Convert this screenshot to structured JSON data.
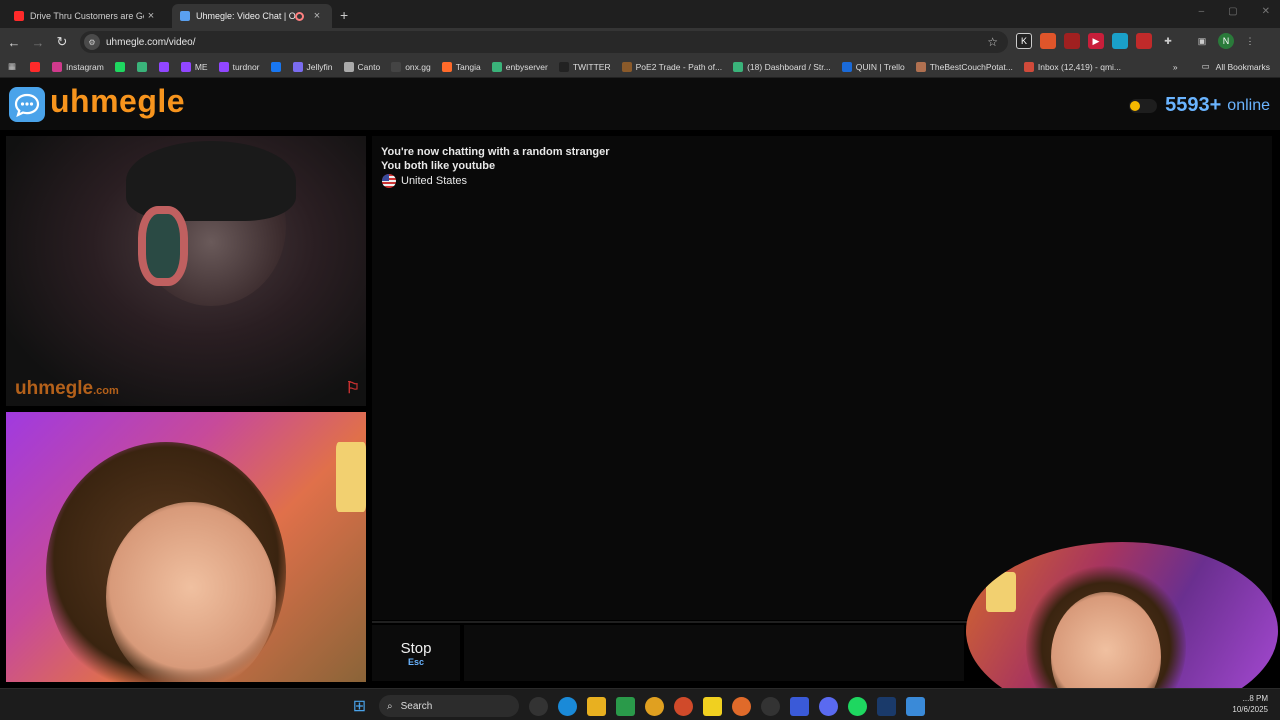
{
  "browser": {
    "tabs": [
      {
        "title": "Drive Thru Customers are Getti",
        "color": "#ff2a2a",
        "active": false
      },
      {
        "title": "Uhmegle: Video Chat | Ome",
        "color": "#5aa0f0",
        "active": true
      }
    ],
    "new_tab_symbol": "+",
    "close_symbol": "×",
    "window_controls": [
      "–",
      "▢",
      "✕"
    ],
    "url": "uhmegle.com/video/",
    "bookmarks": [
      {
        "label": "",
        "color": "#ff2a2a"
      },
      {
        "label": "Instagram",
        "color": "#d03a8c"
      },
      {
        "label": "",
        "color": "#1ed760"
      },
      {
        "label": "",
        "color": "#3ab37a"
      },
      {
        "label": "",
        "color": "#9146ff"
      },
      {
        "label": "ME",
        "color": "#9146ff"
      },
      {
        "label": "turdnor",
        "color": "#9146ff"
      },
      {
        "label": "",
        "color": "#1877f2"
      },
      {
        "label": "Jellyfin",
        "color": "#7a6cf0"
      },
      {
        "label": "Canto",
        "color": "#aaaaaa"
      },
      {
        "label": "onx.gg",
        "color": "#444444"
      },
      {
        "label": "Tangia",
        "color": "#ff6a2a"
      },
      {
        "label": "enbyserver",
        "color": "#3ab37a"
      },
      {
        "label": "TWITTER",
        "color": "#222222"
      },
      {
        "label": "PoE2 Trade - Path of...",
        "color": "#8a5a2a"
      },
      {
        "label": "(18) Dashboard / Str...",
        "color": "#3ab37a"
      },
      {
        "label": "QUIN | Trello",
        "color": "#1a6ad8"
      },
      {
        "label": "TheBestCouchPotat...",
        "color": "#b07050"
      },
      {
        "label": "Inbox (12,419) - qmi...",
        "color": "#d04a3a"
      }
    ],
    "bookmarks_more": "»",
    "all_bookmarks": "All Bookmarks",
    "profile_initial": "N"
  },
  "site": {
    "logo_text": "uhmegle",
    "online_count": "5593+",
    "online_label": "online",
    "watermark_main": "uhmegle",
    "watermark_suffix": ".com",
    "chat_lines": [
      "You're now chatting with a random stranger",
      "You both like youtube"
    ],
    "country": "United States",
    "stop_label": "Stop",
    "stop_hint": "Esc"
  },
  "taskbar": {
    "search_label": "Search",
    "clock_time": "...8 PM",
    "clock_date": "10/6/2025"
  },
  "colors": {
    "brand_orange": "#f7941d",
    "accent_blue": "#6ab4ff",
    "logo_blue": "#4aa3ea"
  }
}
